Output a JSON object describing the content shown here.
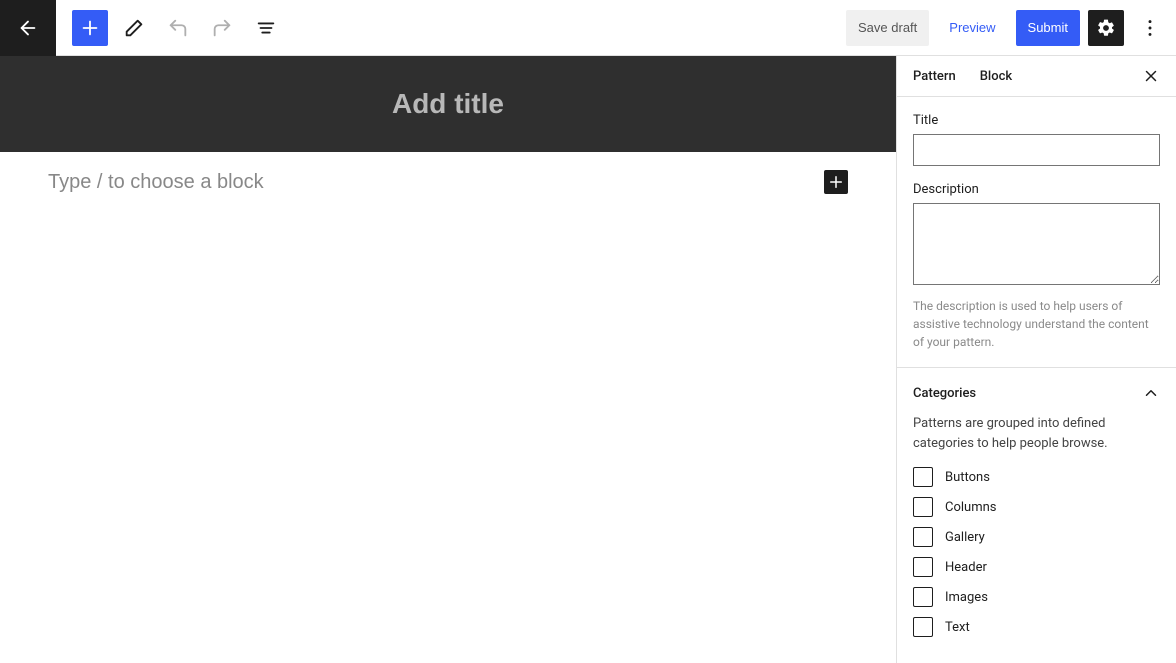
{
  "topbar": {
    "save_draft": "Save draft",
    "preview": "Preview",
    "submit": "Submit"
  },
  "editor": {
    "title_placeholder": "Add title",
    "block_placeholder": "Type / to choose a block"
  },
  "sidebar": {
    "tabs": {
      "pattern": "Pattern",
      "block": "Block"
    },
    "title_field": {
      "label": "Title",
      "value": ""
    },
    "description_field": {
      "label": "Description",
      "value": "",
      "help": "The description is used to help users of assistive technology understand the content of your pattern."
    },
    "categories": {
      "label": "Categories",
      "desc": "Patterns are grouped into defined categories to help people browse.",
      "items": [
        {
          "label": "Buttons",
          "checked": false
        },
        {
          "label": "Columns",
          "checked": false
        },
        {
          "label": "Gallery",
          "checked": false
        },
        {
          "label": "Header",
          "checked": false
        },
        {
          "label": "Images",
          "checked": false
        },
        {
          "label": "Text",
          "checked": false
        }
      ]
    }
  }
}
